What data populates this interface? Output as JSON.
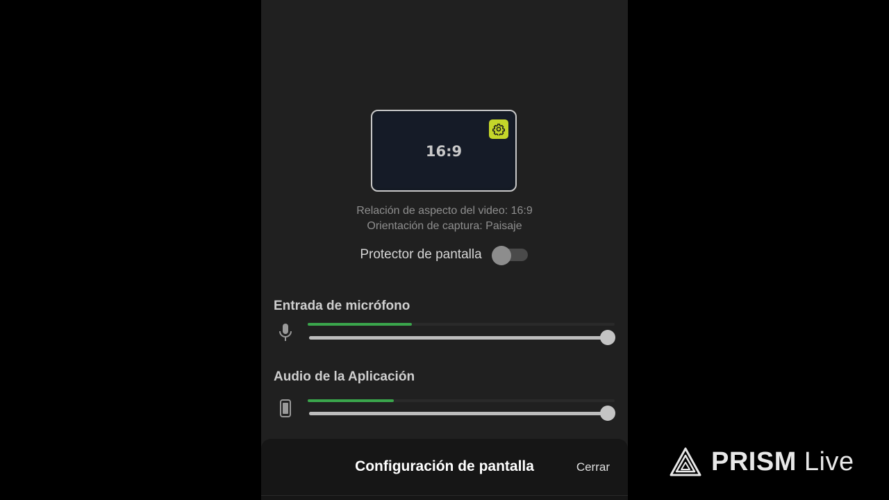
{
  "preview": {
    "ratio_label": "16:9",
    "settings_icon": "gear-icon",
    "badge_color": "#c4d62a"
  },
  "info": {
    "aspect_ratio_line": "Relación de aspecto del video: 16:9",
    "orientation_line": "Orientación de captura: Paisaje"
  },
  "screen_protector": {
    "label": "Protector de pantalla",
    "enabled": false
  },
  "microphone": {
    "title": "Entrada de micrófono",
    "icon": "microphone-icon",
    "level_fraction": 0.34,
    "volume_fraction": 1.0
  },
  "app_audio": {
    "title": "Audio de la Aplicación",
    "icon": "phone-icon",
    "level_fraction": 0.28,
    "volume_fraction": 1.0
  },
  "sheet": {
    "title": "Configuración de pantalla",
    "close_label": "Cerrar"
  },
  "watermark": {
    "brand_bold": "PRISM",
    "brand_light": "Live",
    "logo_icon": "prism-triangle-icon"
  },
  "colors": {
    "accent_green": "#3aa64c",
    "background": "#202020"
  }
}
